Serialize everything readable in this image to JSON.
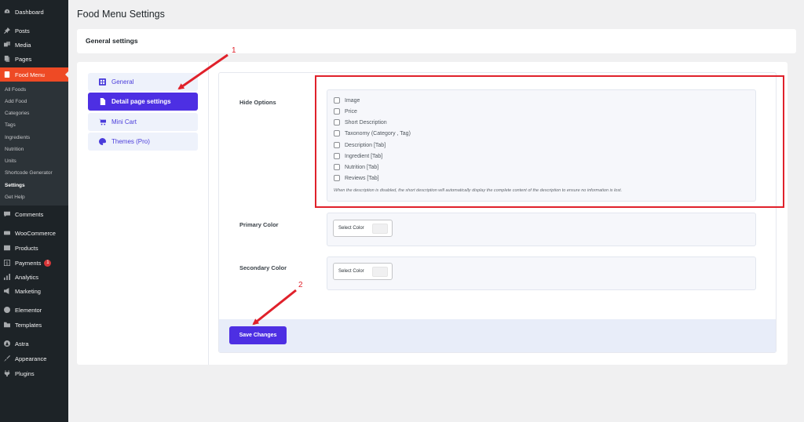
{
  "sidebar": {
    "items": [
      {
        "label": "Dashboard",
        "icon": "dashboard-icon"
      },
      {
        "label": "Posts",
        "icon": "pin-icon"
      },
      {
        "label": "Media",
        "icon": "media-icon"
      },
      {
        "label": "Pages",
        "icon": "pages-icon"
      },
      {
        "label": "Food Menu",
        "icon": "food-menu-icon"
      },
      {
        "label": "Comments",
        "icon": "comments-icon"
      },
      {
        "label": "WooCommerce",
        "icon": "woocommerce-icon"
      },
      {
        "label": "Products",
        "icon": "products-icon"
      },
      {
        "label": "Payments",
        "icon": "payments-icon",
        "badge": "1"
      },
      {
        "label": "Analytics",
        "icon": "analytics-icon"
      },
      {
        "label": "Marketing",
        "icon": "marketing-icon"
      },
      {
        "label": "Elementor",
        "icon": "elementor-icon"
      },
      {
        "label": "Templates",
        "icon": "templates-icon"
      },
      {
        "label": "Astra",
        "icon": "astra-icon"
      },
      {
        "label": "Appearance",
        "icon": "appearance-icon"
      },
      {
        "label": "Plugins",
        "icon": "plugins-icon"
      }
    ],
    "submenu": [
      "All Foods",
      "Add Food",
      "Categories",
      "Tags",
      "Ingredients",
      "Nutrition",
      "Units",
      "Shortcode Generator",
      "Settings",
      "Get Help"
    ]
  },
  "page_title": "Food Menu Settings",
  "general_settings": "General settings",
  "nav": [
    {
      "label": "General",
      "icon": "grid-icon"
    },
    {
      "label": "Detail page settings",
      "icon": "document-icon"
    },
    {
      "label": "Mini Cart",
      "icon": "cart-icon"
    },
    {
      "label": "Themes (Pro)",
      "icon": "palette-icon"
    }
  ],
  "hide_options": {
    "label": "Hide Options",
    "options": [
      "Image",
      "Price",
      "Short Description",
      "Taxonomy (Category , Tag)",
      "Description [Tab]",
      "Ingredient [Tab]",
      "Nutrition [Tab]",
      "Reviews [Tab]"
    ],
    "note": "When the description is disabled, the short description will automatically display the complete content of the description to ensure no information is lost."
  },
  "primary_color": {
    "label": "Primary Color",
    "button": "Select Color"
  },
  "secondary_color": {
    "label": "Secondary Color",
    "button": "Select Color"
  },
  "save_label": "Save Changes",
  "annotations": [
    "1",
    "2"
  ],
  "colors": {
    "sidebar_bg": "#1d2327",
    "food_menu_active": "#ee4a25",
    "accent": "#4d2fe3",
    "annotation_red": "#e0212b"
  }
}
